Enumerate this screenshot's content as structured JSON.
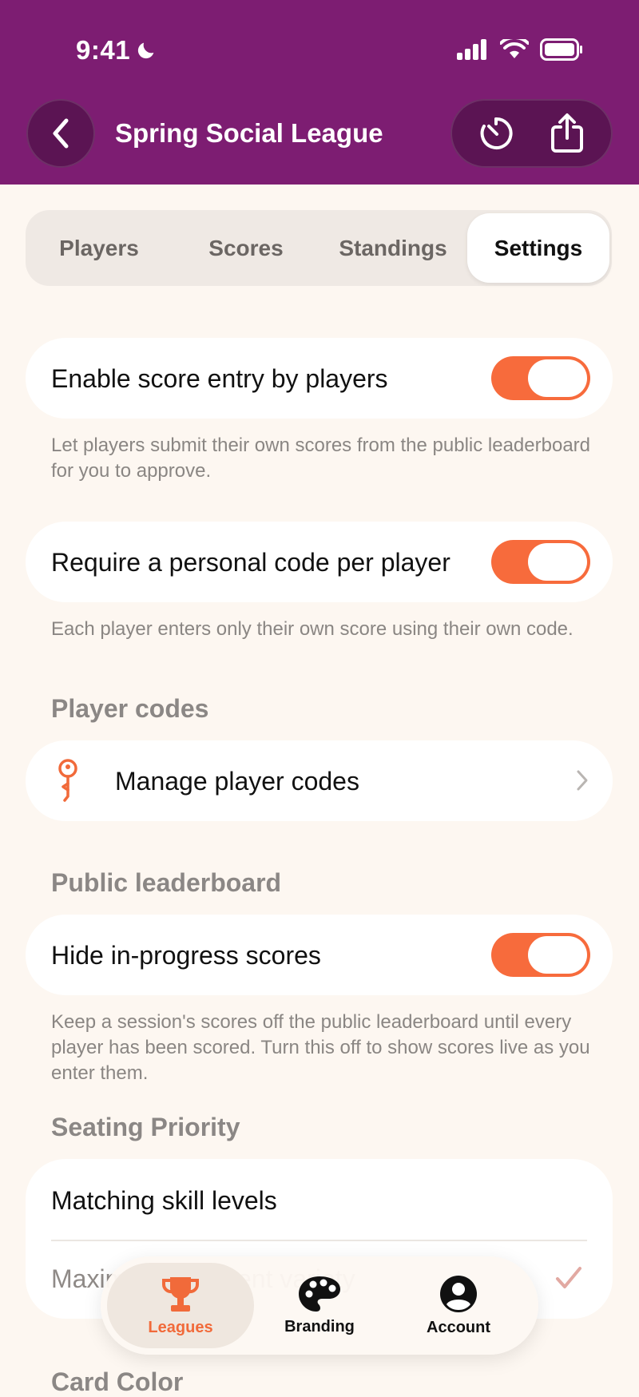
{
  "status_bar": {
    "time": "9:41"
  },
  "header": {
    "title": "Spring Social League"
  },
  "tabs": [
    {
      "label": "Players"
    },
    {
      "label": "Scores"
    },
    {
      "label": "Standings"
    },
    {
      "label": "Settings"
    }
  ],
  "active_tab": "Settings",
  "settings": {
    "score_entry": {
      "label": "Enable score entry by players",
      "enabled": true,
      "help": "Let players submit their own scores from the public leaderboard for you to approve."
    },
    "personal_code": {
      "label": "Require a personal code per player",
      "enabled": true,
      "help": "Each player enters only their own score using their own code."
    },
    "player_codes": {
      "section_title": "Player codes",
      "manage_label": "Manage player codes"
    },
    "public_leaderboard": {
      "section_title": "Public leaderboard",
      "hide_label": "Hide in-progress scores",
      "enabled": true,
      "help": "Keep a session's scores off the public leaderboard until every player has been scored. Turn this off to show scores live as you enter them."
    },
    "seating_priority": {
      "section_title": "Seating Priority",
      "options": [
        {
          "label": "Matching skill levels",
          "selected": false
        },
        {
          "label": "Maximize opponent variety",
          "selected": true
        }
      ]
    },
    "next_section_title": "Card Color"
  },
  "tabbar": [
    {
      "label": "Leagues",
      "icon": "trophy-icon",
      "active": true
    },
    {
      "label": "Branding",
      "icon": "palette-icon",
      "active": false
    },
    {
      "label": "Account",
      "icon": "account-icon",
      "active": false
    }
  ],
  "colors": {
    "header": "#7d1d72",
    "accent": "#f76b3c",
    "background": "#fdf7f1"
  }
}
